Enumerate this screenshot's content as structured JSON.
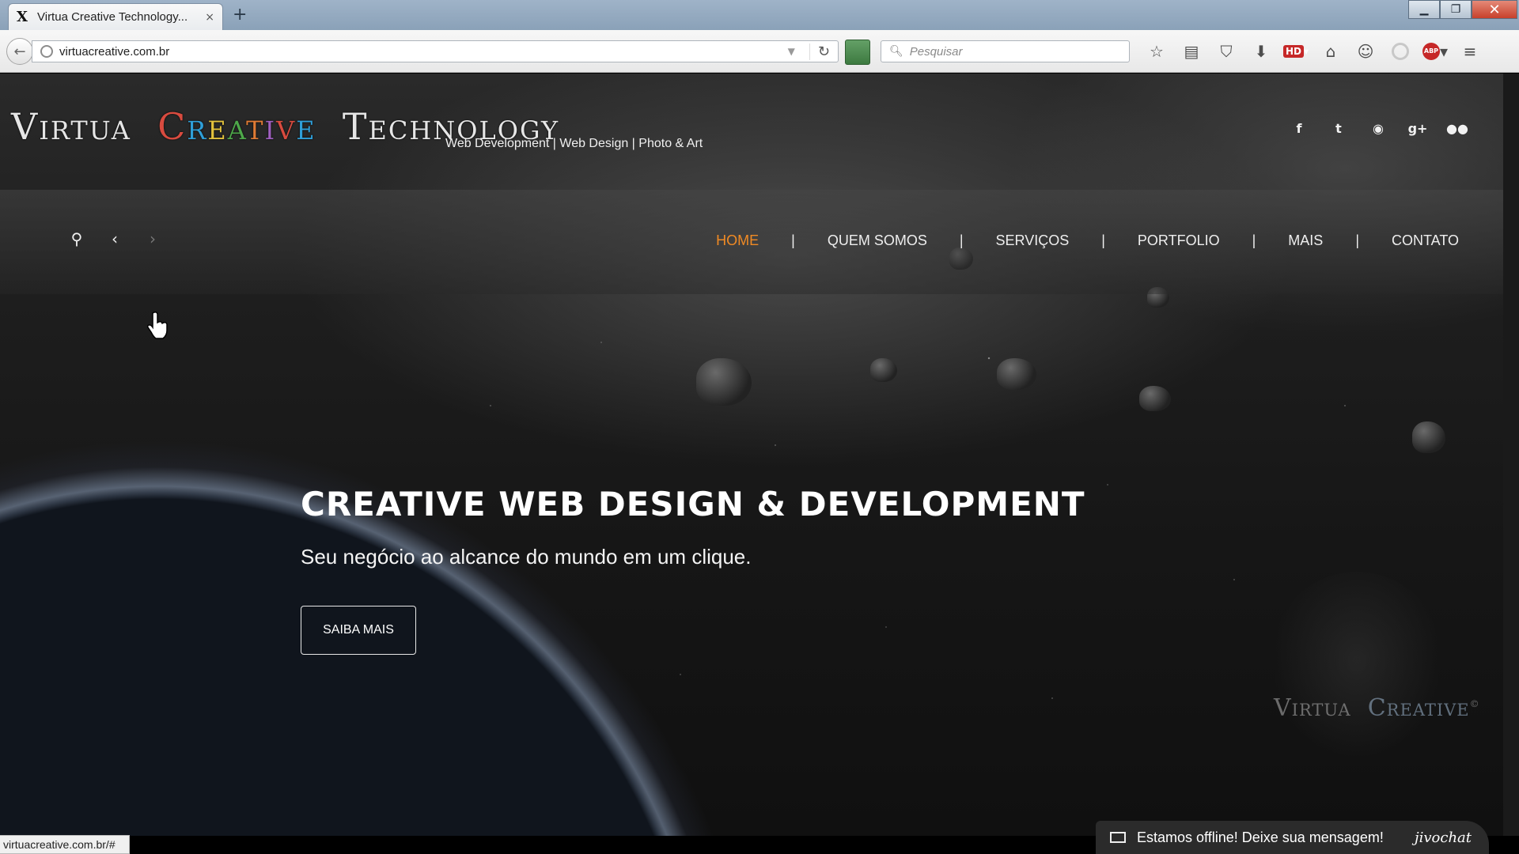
{
  "browser": {
    "tab_title": "Virtua Creative Technology...",
    "tab_close": "×",
    "new_tab": "+",
    "url": "virtuacreative.com.br",
    "search_placeholder": "Pesquisar",
    "status_url": "virtuacreative.com.br/#",
    "toolbar_icons": [
      "star-icon",
      "reading-list-icon",
      "pocket-icon",
      "download-icon",
      "hd-icon",
      "home-icon",
      "chat-icon",
      "notifications-icon",
      "adblock-icon",
      "menu-icon"
    ],
    "hd_label": "HD",
    "abp_label": "ABP"
  },
  "site": {
    "logo": {
      "word1": "Virtua",
      "word2_letters": [
        "C",
        "r",
        "e",
        "a",
        "t",
        "i",
        "v",
        "e"
      ],
      "word3": "Technology"
    },
    "tagline": "Web Development | Web Design | Photo & Art",
    "social_icons": [
      "facebook-icon",
      "twitter-icon",
      "github-icon",
      "google-plus-icon",
      "flickr-icon"
    ],
    "social_glyphs": [
      "f",
      "t",
      "◉",
      "g+",
      "●●"
    ],
    "menu": {
      "items": [
        "HOME",
        "QUEM SOMOS",
        "SERVIÇOS",
        "PORTFOLIO",
        "MAIS",
        "CONTATO"
      ],
      "separator": "|",
      "active": "HOME",
      "active_color": "#f08a24"
    },
    "hero": {
      "title": "CREATIVE WEB DESIGN & DEVELOPMENT",
      "subtitle": "Seu negócio ao alcance do mundo em um clique.",
      "button": "SAIBA MAIS"
    },
    "watermark": {
      "word1": "Virtua",
      "word2": "Creative",
      "mark": "©"
    },
    "chat": {
      "message": "Estamos offline! Deixe sua mensagem!",
      "brand": "jivochat"
    }
  }
}
